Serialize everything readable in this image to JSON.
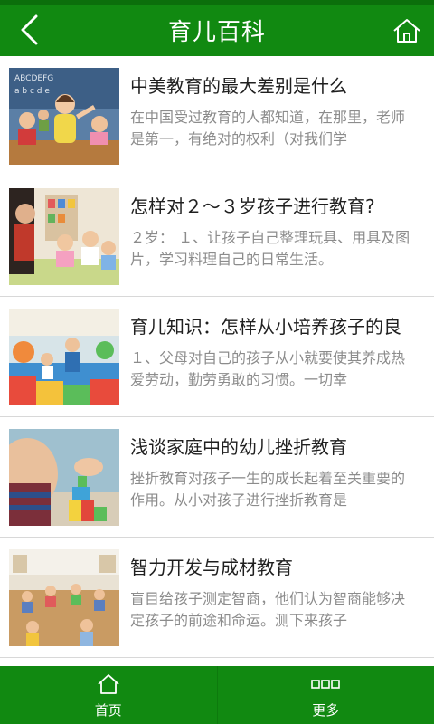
{
  "header": {
    "title": "育儿百科",
    "back_icon": "back-arrow-icon",
    "home_icon": "home-icon"
  },
  "articles": [
    {
      "title": "中美教育的最大差别是什么",
      "summary": "在中国受过教育的人都知道，在那里，老师是第一，有绝对的权利（对我们学",
      "thumbnail": "classroom-photo"
    },
    {
      "title": "怎样对２～３岁孩子进行教育?",
      "summary": "２岁： １、让孩子自己整理玩具、用具及图片，学习料理自己的日常生活。",
      "thumbnail": "kids-playing-photo"
    },
    {
      "title": "育儿知识：怎样从小培养孩子的良",
      "summary": "１、父母对自己的孩子从小就要使其养成热爱劳动，勤劳勇敢的习惯。一切幸",
      "thumbnail": "playroom-photo"
    },
    {
      "title": "浅谈家庭中的幼儿挫折教育",
      "summary": "挫折教育对孩子一生的成长起着至关重要的作用。从小对孩子进行挫折教育是",
      "thumbnail": "building-blocks-photo"
    },
    {
      "title": "智力开发与成材教育",
      "summary": "盲目给孩子测定智商，他们认为智商能够决定孩子的前途和命运。测下来孩子",
      "thumbnail": "kindergarten-photo"
    }
  ],
  "tabbar": {
    "home_label": "首页",
    "home_icon": "home-icon",
    "more_label": "更多",
    "more_icon": "more-dots-icon"
  },
  "colors": {
    "primary": "#118911",
    "title_text": "#1f1f1f",
    "summary_text": "#8c8c8c"
  }
}
